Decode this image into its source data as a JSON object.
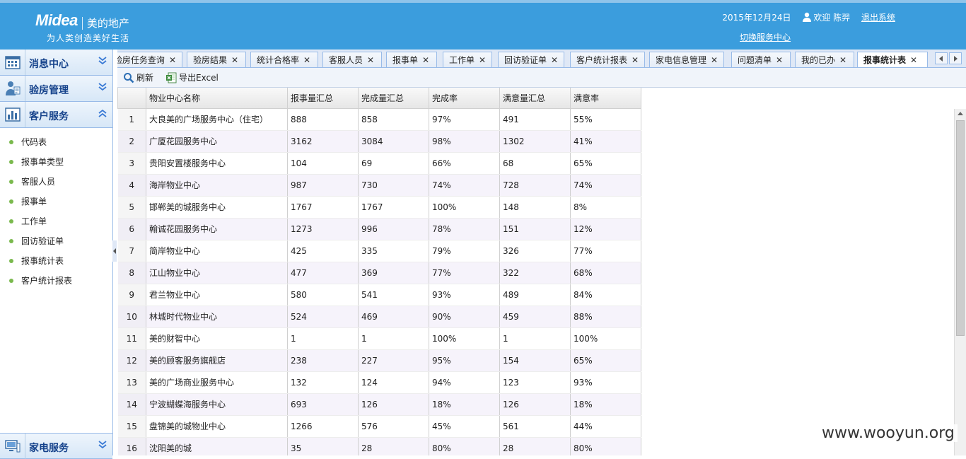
{
  "header": {
    "brand": "Midea",
    "brand_cn": "美的地产",
    "slogan": "为人类创造美好生活",
    "date": "2015年12月24日",
    "welcome": "欢迎 陈羿",
    "logout": "退出系统",
    "switch_center": "切换服务中心",
    "bg_color": "#3b9ddd"
  },
  "sidebar": {
    "groups": [
      {
        "label": "消息中心",
        "icon": "calendar-icon"
      },
      {
        "label": "验房管理",
        "icon": "inspector-icon"
      },
      {
        "label": "客户服务",
        "icon": "chart-icon"
      }
    ],
    "items": [
      "代码表",
      "报事单类型",
      "客服人员",
      "报事单",
      "工作单",
      "回访验证单",
      "报事统计表",
      "客户统计报表"
    ],
    "bottom_group": {
      "label": "家电服务",
      "icon": "computer-icon"
    }
  },
  "tabs": [
    {
      "label": "验房任务查询"
    },
    {
      "label": "验房结果"
    },
    {
      "label": "统计合格率"
    },
    {
      "label": "客服人员"
    },
    {
      "label": "报事单"
    },
    {
      "label": "工作单"
    },
    {
      "label": "回访验证单"
    },
    {
      "label": "客户统计报表"
    },
    {
      "label": "家电信息管理"
    },
    {
      "label": "问题清单"
    },
    {
      "label": "我的已办"
    },
    {
      "label": "报事统计表"
    }
  ],
  "close_glyph": "✕",
  "toolbar": {
    "refresh": "刷新",
    "export": "导出Excel"
  },
  "grid": {
    "columns": [
      "物业中心名称",
      "报事量汇总",
      "完成量汇总",
      "完成率",
      "满意量汇总",
      "满意率"
    ],
    "rows": [
      [
        "1",
        "大良美的广场服务中心（住宅）",
        "888",
        "858",
        "97%",
        "491",
        "55%"
      ],
      [
        "2",
        "广厦花园服务中心",
        "3162",
        "3084",
        "98%",
        "1302",
        "41%"
      ],
      [
        "3",
        "贵阳安置楼服务中心",
        "104",
        "69",
        "66%",
        "68",
        "65%"
      ],
      [
        "4",
        "海岸物业中心",
        "987",
        "730",
        "74%",
        "728",
        "74%"
      ],
      [
        "5",
        "邯郸美的城服务中心",
        "1767",
        "1767",
        "100%",
        "148",
        "8%"
      ],
      [
        "6",
        "翰诚花园服务中心",
        "1273",
        "996",
        "78%",
        "151",
        "12%"
      ],
      [
        "7",
        "简岸物业中心",
        "425",
        "335",
        "79%",
        "326",
        "77%"
      ],
      [
        "8",
        "江山物业中心",
        "477",
        "369",
        "77%",
        "322",
        "68%"
      ],
      [
        "9",
        "君兰物业中心",
        "580",
        "541",
        "93%",
        "489",
        "84%"
      ],
      [
        "10",
        "林城时代物业中心",
        "524",
        "469",
        "90%",
        "459",
        "88%"
      ],
      [
        "11",
        "美的财智中心",
        "1",
        "1",
        "100%",
        "1",
        "100%"
      ],
      [
        "12",
        "美的顾客服务旗舰店",
        "238",
        "227",
        "95%",
        "154",
        "65%"
      ],
      [
        "13",
        "美的广场商业服务中心",
        "132",
        "124",
        "94%",
        "123",
        "93%"
      ],
      [
        "14",
        "宁波蝴蝶海服务中心",
        "693",
        "126",
        "18%",
        "126",
        "18%"
      ],
      [
        "15",
        "盘锦美的城物业中心",
        "1266",
        "576",
        "45%",
        "561",
        "44%"
      ],
      [
        "16",
        "沈阳美的城",
        "35",
        "28",
        "80%",
        "28",
        "80%"
      ]
    ]
  },
  "watermark": "www.wooyun.org"
}
